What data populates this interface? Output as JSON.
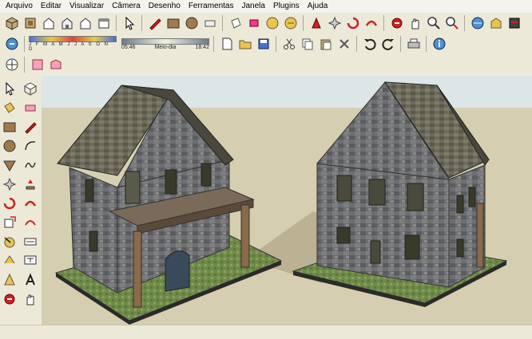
{
  "menu": [
    "Arquivo",
    "Editar",
    "Visualizar",
    "Câmera",
    "Desenho",
    "Ferramentas",
    "Janela",
    "Plugins",
    "Ajuda"
  ],
  "shadows": {
    "months": "J F M A M J J A S O N D",
    "time_start": "05:46",
    "time_mid": "Meio-dia",
    "time_end": "18:42"
  },
  "colors": {
    "sky": "#dde6e7",
    "ground": "#d6ceb0",
    "accent_red": "#cc2222",
    "ui_bg": "#ece9d8"
  },
  "icons": {
    "toolbar1": [
      "iso-view-icon",
      "top-view-icon",
      "front-view-icon",
      "right-view-icon",
      "back-view-icon",
      "left-view-icon",
      "select-arrow-icon",
      "pencil-icon",
      "rectangle-icon",
      "circle-icon",
      "eraser-icon",
      "paint-bucket-icon",
      "push-pull-icon",
      "move-icon",
      "rotate-icon",
      "follow-me-icon",
      "orbit-icon",
      "pan-icon",
      "zoom-icon",
      "zoom-extents-icon",
      "get-models-icon",
      "share-model-icon",
      "ruby-console-icon"
    ],
    "toolbar2": [
      "new-icon",
      "open-icon",
      "save-icon",
      "cut-icon",
      "copy-icon",
      "paste-icon",
      "delete-icon",
      "undo-icon",
      "redo-icon",
      "print-icon",
      "model-info-icon"
    ],
    "sidebar": [
      "select-icon",
      "make-component-icon",
      "paint-bucket-icon",
      "eraser-icon",
      "rectangle-icon",
      "line-icon",
      "circle-icon",
      "arc-icon",
      "polygon-icon",
      "freehand-icon",
      "move-icon",
      "push-pull-icon",
      "rotate-icon",
      "follow-me-icon",
      "scale-icon",
      "offset-icon",
      "tape-measure-icon",
      "dimension-icon",
      "protractor-icon",
      "text-icon",
      "axes-icon",
      "3d-text-icon",
      "orbit-icon",
      "pan-icon"
    ]
  }
}
